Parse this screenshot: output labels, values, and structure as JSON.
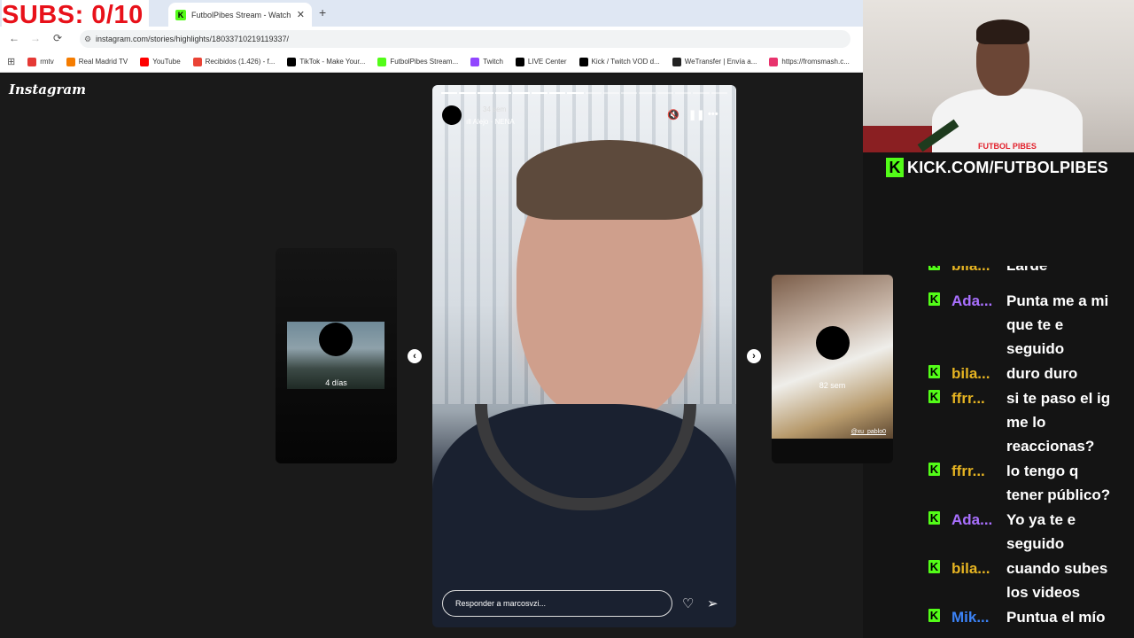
{
  "overlay": {
    "subs_counter": "SUBS: 0/10"
  },
  "browser": {
    "tab": {
      "title": "FutbolPibes Stream - Watch Live",
      "close": "✕",
      "new_tab": "+"
    },
    "nav": {
      "back": "←",
      "forward": "→",
      "reload": "⟳"
    },
    "url": "instagram.com/stories/highlights/18033710219119337/",
    "bookmarks": [
      {
        "label": "rmtv",
        "color": "#e53935"
      },
      {
        "label": "Real Madrid TV",
        "color": "#f57c00"
      },
      {
        "label": "YouTube",
        "color": "#ff0000"
      },
      {
        "label": "Recibidos (1.426) - f...",
        "color": "#ea4335"
      },
      {
        "label": "TikTok - Make Your...",
        "color": "#000000"
      },
      {
        "label": "FutbolPibes Stream...",
        "color": "#53fc18"
      },
      {
        "label": "Twitch",
        "color": "#9146ff"
      },
      {
        "label": "LIVE Center",
        "color": "#000000"
      },
      {
        "label": "Kick / Twitch VOD d...",
        "color": "#000000"
      },
      {
        "label": "WeTransfer | Envía a...",
        "color": "#222222"
      },
      {
        "label": "https://fromsmash.c...",
        "color": "#e8336d"
      }
    ]
  },
  "instagram": {
    "logo": "Instagram",
    "left_story": {
      "label": "4 días"
    },
    "right_story": {
      "label": "82 sem",
      "handle": "@xu_pablo0"
    },
    "story": {
      "time": "34 sem",
      "song": "Alejo · NENA",
      "reply_placeholder": "Responder a marcosvzi...",
      "progress_total": 16,
      "progress_done": 8
    }
  },
  "stream": {
    "shirt_text": "FUTBOL PIBES",
    "banner": "KICK.COM/FUTBOLPIBES"
  },
  "chat": {
    "partial_top": {
      "user": "bila...",
      "text": "Larde"
    },
    "messages": [
      {
        "user": "Ada...",
        "color": "#a970ff",
        "lines": [
          "Punta me a mi",
          "que te e",
          "seguido"
        ]
      },
      {
        "user": "bila...",
        "color": "#e6b422",
        "lines": [
          "duro duro"
        ]
      },
      {
        "user": "ffrr...",
        "color": "#e6b422",
        "lines": [
          "si te paso el ig",
          "me lo",
          "reaccionas?"
        ]
      },
      {
        "user": "ffrr...",
        "color": "#e6b422",
        "lines": [
          "lo tengo q",
          "tener público?"
        ]
      },
      {
        "user": "Ada...",
        "color": "#a970ff",
        "lines": [
          "Yo ya te e",
          "seguido"
        ]
      },
      {
        "user": "bila...",
        "color": "#e6b422",
        "lines": [
          "cuando subes",
          "los videos"
        ]
      },
      {
        "user": "Mik...",
        "color": "#3b82f6",
        "lines": [
          "Puntua el mío"
        ]
      }
    ]
  }
}
